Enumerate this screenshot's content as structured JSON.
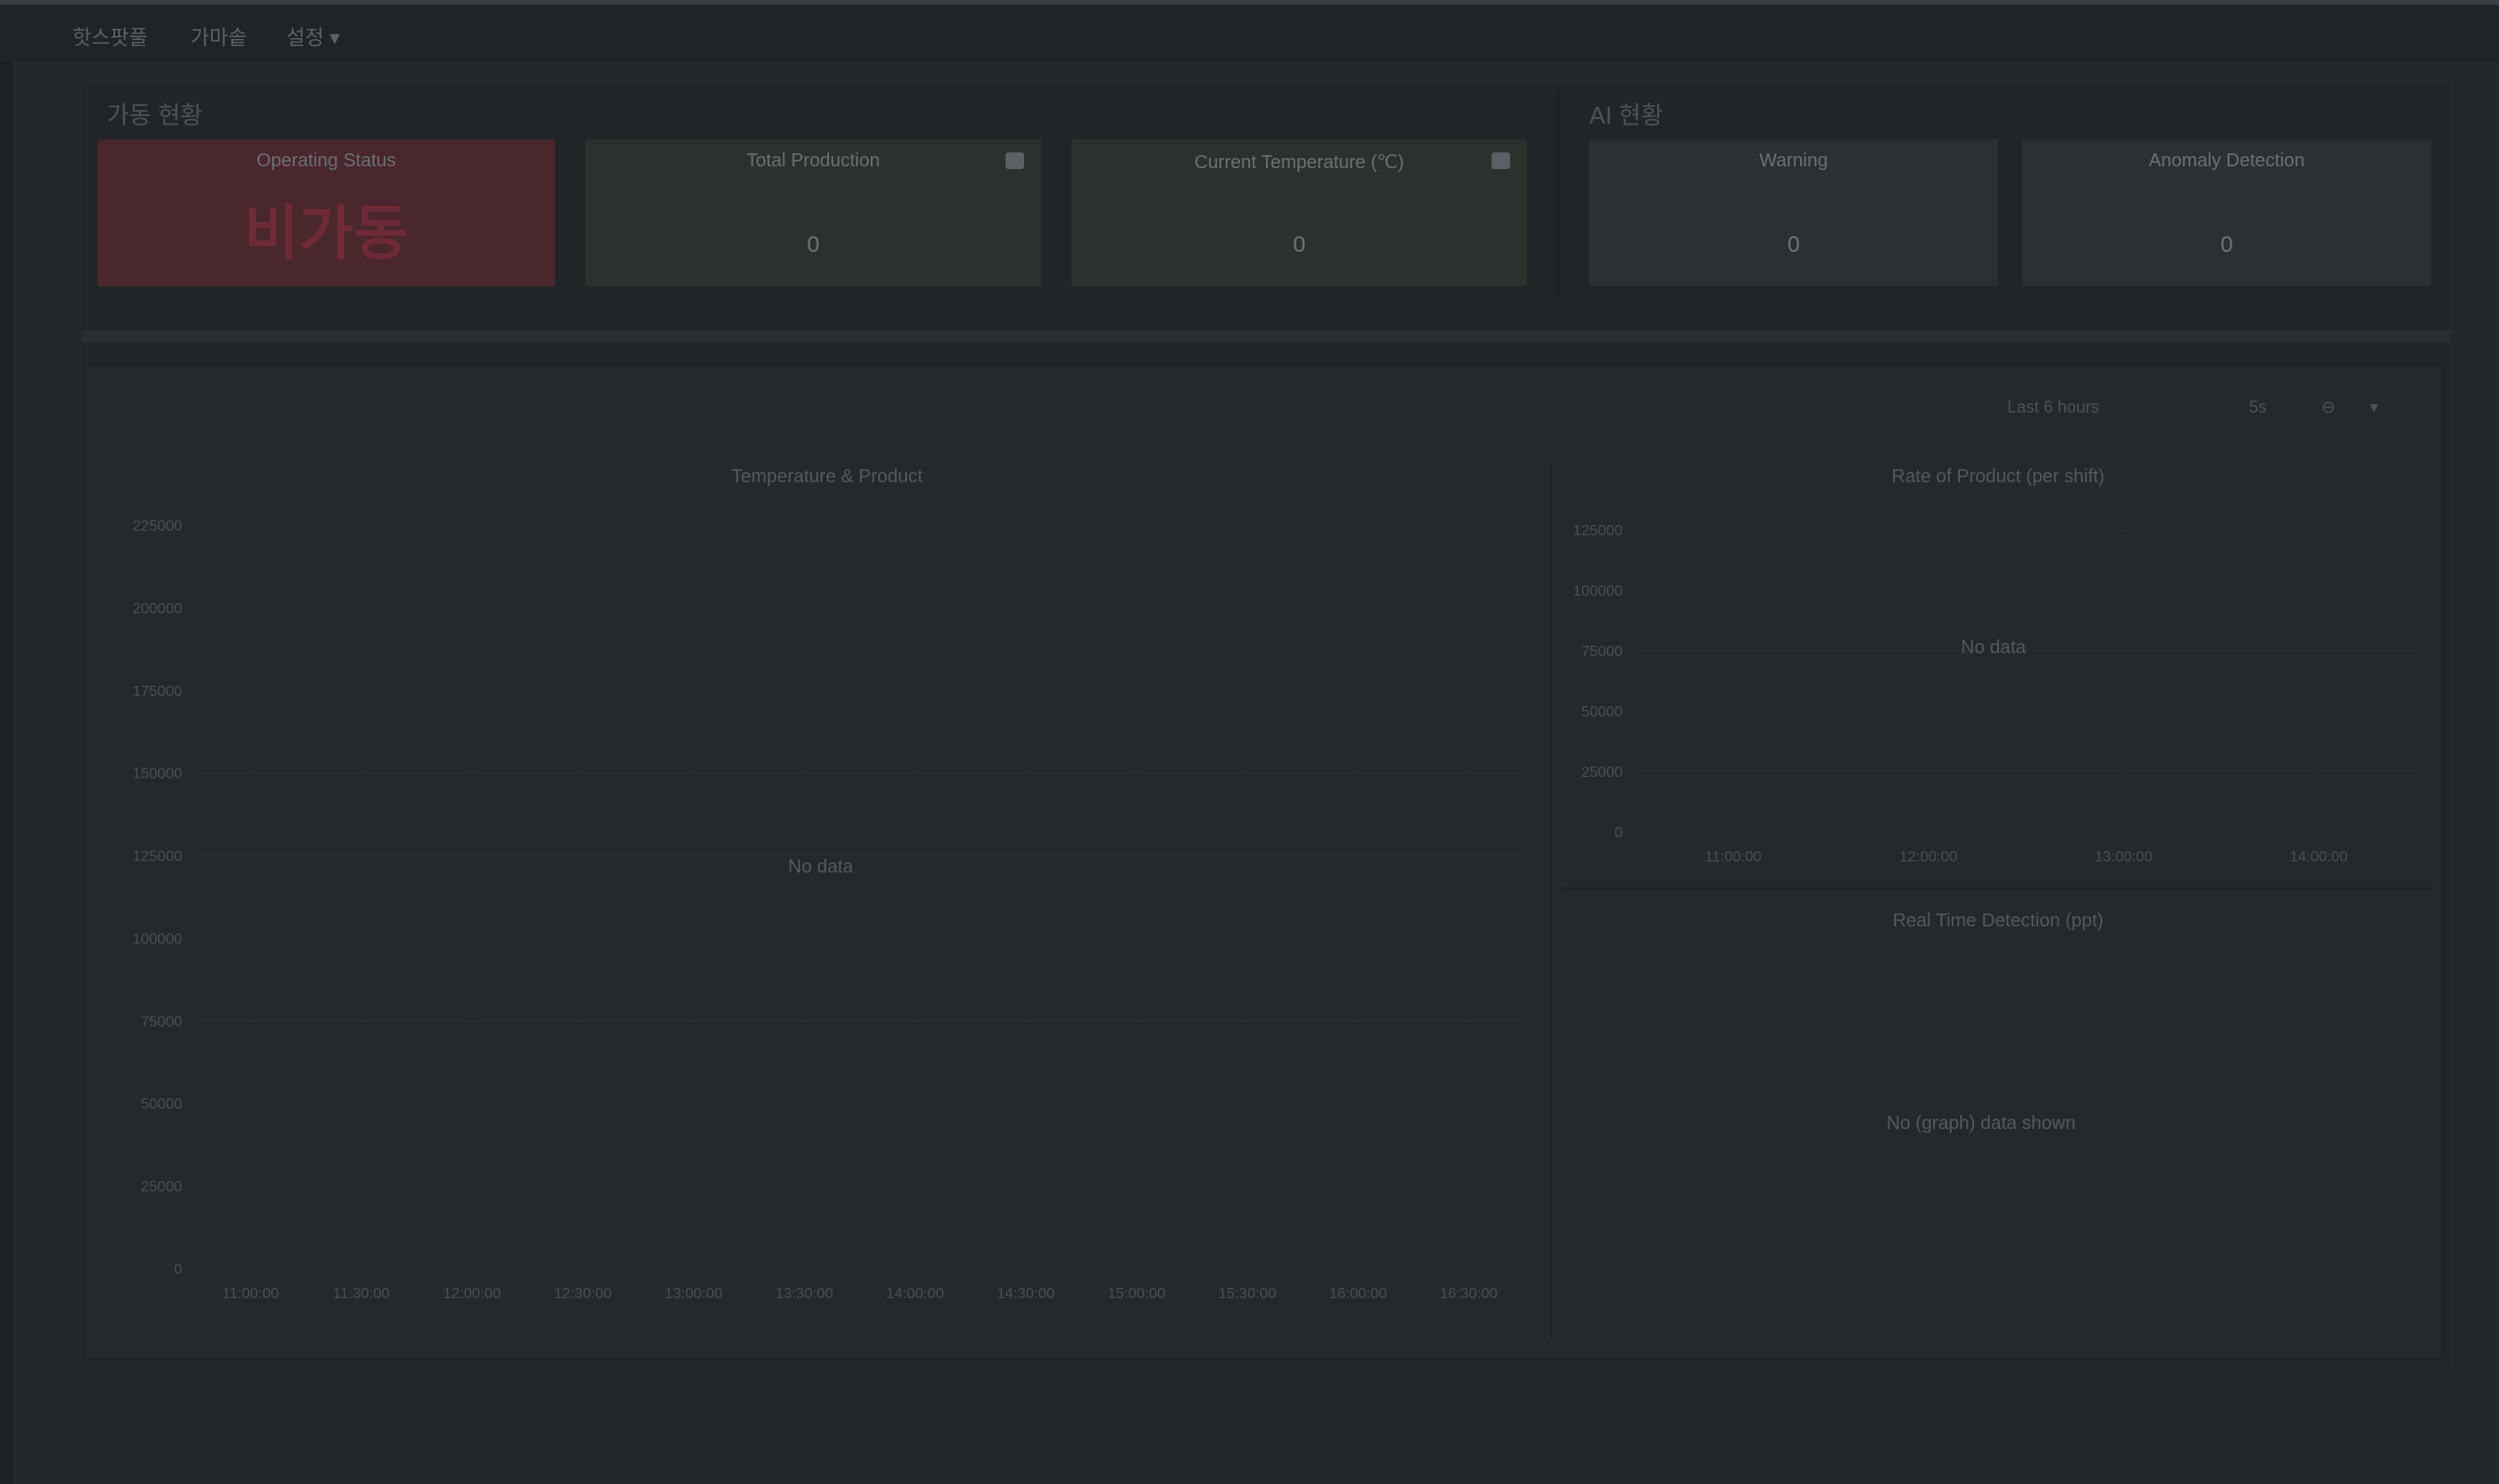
{
  "topbar": {
    "menu": [
      "핫스팟풀",
      "가마솥",
      "설정 ▾"
    ]
  },
  "groups": {
    "left_title": "가동 현황",
    "right_title": "AI 현황"
  },
  "cards": [
    {
      "title": "Operating Status",
      "value": "비가동",
      "color": "#4a262d"
    },
    {
      "title": "Total Production",
      "value": "0",
      "color": "#2c312e"
    },
    {
      "title": "Current Temperature (℃)",
      "value": "0",
      "color": "#2c312e"
    },
    {
      "title": "Warning",
      "value": "0",
      "color": "#2a3033"
    },
    {
      "title": "Anomaly Detection",
      "value": "0",
      "color": "#2a3033"
    }
  ],
  "toolbar": {
    "range": "Last 6 hours",
    "refresh": "5s",
    "zoom": "▾"
  },
  "charts": {
    "left": {
      "title": "Temperature & Product",
      "nodata": "No data",
      "yticks": [
        "0",
        "25000",
        "50000",
        "75000",
        "100000",
        "125000",
        "150000",
        "175000",
        "200000",
        "225000"
      ],
      "xticks": [
        "11:00:00",
        "11:30:00",
        "12:00:00",
        "12:30:00",
        "13:00:00",
        "13:30:00",
        "14:00:00",
        "14:30:00",
        "15:00:00",
        "15:30:00",
        "16:00:00",
        "16:30:00"
      ]
    },
    "right_top": {
      "title": "Rate of Product (per shift)",
      "nodata": "No data",
      "yticks": [
        "0",
        "25000",
        "50000",
        "75000",
        "100000",
        "125000"
      ],
      "xticks": [
        "11:00:00",
        "12:00:00",
        "13:00:00",
        "14:00:00"
      ]
    },
    "right_bottom": {
      "title": "Real Time Detection (ppt)",
      "nodata": "No (graph) data shown"
    }
  }
}
